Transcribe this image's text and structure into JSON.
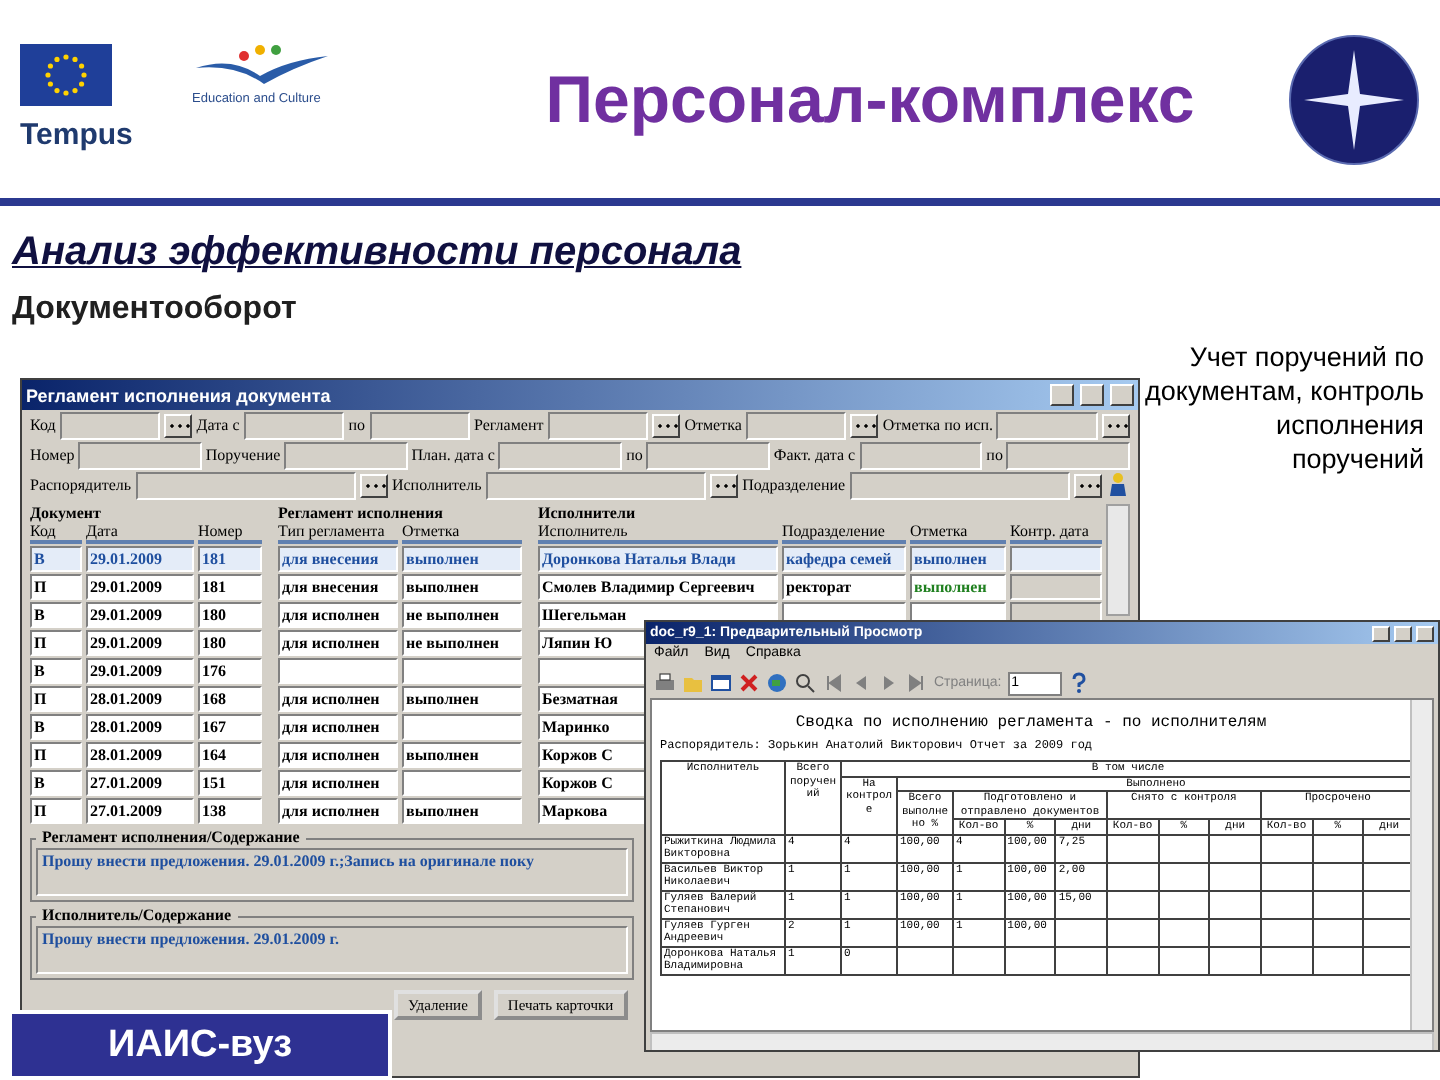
{
  "header": {
    "program": "Education and Culture",
    "logo_text": "Tempus",
    "title": "Персонал-комплекс"
  },
  "heading": "Анализ эффективности персонала",
  "subheading": "Документооборот",
  "note": "Учет поручений по документам, контроль исполнения поручений",
  "badge": "ИАИС-вуз",
  "doc_window": {
    "title": "Регламент исполнения документа",
    "filter_rows": [
      [
        {
          "label": "Код",
          "browse": true
        },
        {
          "label": "Дата с",
          "browse": false
        },
        {
          "label": "по",
          "browse": false
        },
        {
          "label": "Регламент",
          "browse": true
        },
        {
          "label": "Отметка",
          "browse": true
        },
        {
          "label": "Отметка по исп.",
          "browse": true
        }
      ],
      [
        {
          "label": "Номер",
          "browse": false
        },
        {
          "label": "Поручение",
          "browse": false
        },
        {
          "label": "План. дата с",
          "browse": false
        },
        {
          "label": "по",
          "browse": false
        },
        {
          "label": "Факт. дата с",
          "browse": false
        },
        {
          "label": "по",
          "browse": false
        }
      ],
      [
        {
          "label": "Распорядитель",
          "browse": true
        },
        {
          "label": "Исполнитель",
          "browse": true
        },
        {
          "label": "Подразделение",
          "browse": true
        }
      ]
    ],
    "groups": [
      "Документ",
      "Регламент исполнения",
      "Исполнители"
    ],
    "columns": [
      "Код",
      "Дата",
      "Номер",
      "Тип регламента",
      "Отметка",
      "Исполнитель",
      "Подразделение",
      "Отметка",
      "Контр. дата"
    ],
    "rows": [
      {
        "selected": true,
        "code": "В",
        "date": "29.01.2009",
        "number": "181",
        "type": "для внесения",
        "mark": "выполнен",
        "executor": "Доронкова Наталья Влади",
        "dept": "кафедра семей",
        "exec_mark": "выполнен"
      },
      {
        "selected": false,
        "code": "П",
        "date": "29.01.2009",
        "number": "181",
        "type": "для внесения",
        "mark": "выполнен",
        "executor": "Смолев Владимир Сергеевич",
        "dept": "ректорат",
        "exec_mark": "выполнен"
      },
      {
        "selected": false,
        "code": "В",
        "date": "29.01.2009",
        "number": "180",
        "type": "для исполнен",
        "mark": "не выполнен",
        "executor": "Шегельман"
      },
      {
        "selected": false,
        "code": "П",
        "date": "29.01.2009",
        "number": "180",
        "type": "для исполнен",
        "mark": "не выполнен",
        "executor": "Ляпин Ю"
      },
      {
        "selected": false,
        "code": "В",
        "date": "29.01.2009",
        "number": "176"
      },
      {
        "selected": false,
        "code": "П",
        "date": "28.01.2009",
        "number": "168",
        "type": "для исполнен",
        "mark": "выполнен",
        "executor": "Безматная"
      },
      {
        "selected": false,
        "code": "В",
        "date": "28.01.2009",
        "number": "167",
        "type": "для исполнен",
        "executor": "Маринко"
      },
      {
        "selected": false,
        "code": "П",
        "date": "28.01.2009",
        "number": "164",
        "type": "для исполнен",
        "mark": "выполнен",
        "executor": "Коржов С"
      },
      {
        "selected": false,
        "code": "В",
        "date": "27.01.2009",
        "number": "151",
        "type": "для исполнен",
        "executor": "Коржов С"
      },
      {
        "selected": false,
        "code": "П",
        "date": "27.01.2009",
        "number": "138",
        "type": "для исполнен",
        "mark": "выполнен",
        "executor": "Маркова"
      }
    ],
    "sections": [
      {
        "label": "Регламент исполнения/Содержание",
        "text": "Прошу внести предложения. 29.01.2009 г.;Запись на оригинале поку"
      },
      {
        "label": "Исполнитель/Содержание",
        "text": "Прошу внести предложения. 29.01.2009 г."
      }
    ],
    "buttons": [
      "Удаление",
      "Печать карточки"
    ]
  },
  "report_window": {
    "title": "doc_r9_1: Предварительный Просмотр",
    "menu": [
      "Файл",
      "Вид",
      "Справка"
    ],
    "page_label": "Страница:",
    "page_value": "1",
    "report_title": "Сводка по исполнению регламента - по исполнителям",
    "report_subtitle": "Распорядитель: Зорькин Анатолий Викторович  Отчет за 2009 год",
    "headers": {
      "executor": "Исполнитель",
      "total": "Всего поручений",
      "in_total": "В том числе",
      "on_control": "На контроле",
      "done": "Выполнено",
      "done_pct": "Всего выполнено %",
      "groups": [
        {
          "label": "Подготовлено и отправлено документов",
          "subs": [
            "Кол-во",
            "%",
            "дни"
          ]
        },
        {
          "label": "Снято с контроля",
          "subs": [
            "Кол-во",
            "%",
            "дни"
          ]
        },
        {
          "label": "Просрочено",
          "subs": [
            "Кол-во",
            "%",
            "дни"
          ]
        }
      ]
    },
    "rows": [
      {
        "name": "Рыжиткина Людмила Викторовна",
        "total": "4",
        "on_control": "4",
        "done_pct": "100,00",
        "prepared": [
          "4",
          "100,00",
          "7,25"
        ]
      },
      {
        "name": "Васильев Виктор Николаевич",
        "total": "1",
        "on_control": "1",
        "done_pct": "100,00",
        "prepared": [
          "1",
          "100,00",
          "2,00"
        ]
      },
      {
        "name": "Гуляев Валерий Степанович",
        "total": "1",
        "on_control": "1",
        "done_pct": "100,00",
        "prepared": [
          "1",
          "100,00",
          "15,00"
        ]
      },
      {
        "name": "Гуляев Гурген Андреевич",
        "total": "2",
        "on_control": "1",
        "done_pct": "100,00",
        "prepared": [
          "1",
          "100,00"
        ]
      },
      {
        "name": "Доронкова Наталья Владимировна",
        "total": "1",
        "on_control": "0",
        "prepared": []
      }
    ]
  }
}
